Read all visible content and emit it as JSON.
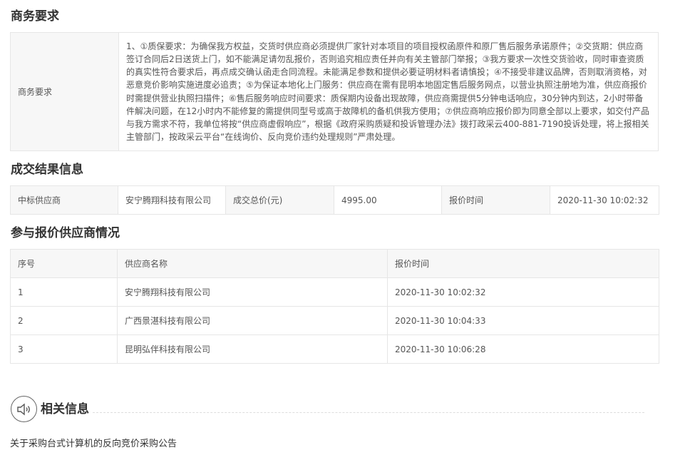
{
  "business": {
    "section_title": "商务要求",
    "label": "商务要求",
    "content": "1、①质保要求：为确保我方权益，交货时供应商必须提供厂家针对本项目的项目授权函原件和原厂售后服务承诺原件；②交货期：供应商签订合同后2日送货上门，如不能满足请勿乱报价，否则追究相应责任并向有关主管部门举报；③我方要求一次性交货验收，同时审查资质的真实性符合要求后，再点成交确认函走合同流程。未能满足参数和提供必要证明材料者请慎投；④不接受非建议品牌，否则取消资格，对恶意竞价影响实施进度必追责；⑤为保证本地化上门服务：供应商在需有昆明本地固定售后服务网点，以营业执照注册地为准，供应商报价时需提供营业执照扫描件；⑥售后服务响应时间要求：质保期内设备出现故障，供应商需提供5分钟电话响应，30分钟内到达，2小时带备件解决问题，在12小时内不能修复的需提供同型号或高于故障机的备机供我方使用；⑦供应商响应报价即为同意全部以上要求，如交付产品与我方需求不符，我单位将按“供应商虚假响应”，根据《政府采购质疑和投诉管理办法》拨打政采云400-881-7190投诉处理，将上报相关主管部门，按政采云平台“在线询价、反向竞价违约处理规则”严肃处理。"
  },
  "result": {
    "section_title": "成交结果信息",
    "winner_label": "中标供应商",
    "winner_value": "安宁腾翔科技有限公司",
    "total_label": "成交总价(元)",
    "total_value": "4995.00",
    "time_label": "报价时间",
    "time_value": "2020-11-30 10:02:32"
  },
  "bids": {
    "section_title": "参与报价供应商情况",
    "headers": [
      "序号",
      "供应商名称",
      "报价时间"
    ],
    "rows": [
      {
        "no": "1",
        "name": "安宁腾翔科技有限公司",
        "time": "2020-11-30 10:02:32"
      },
      {
        "no": "2",
        "name": "广西景湛科技有限公司",
        "time": "2020-11-30 10:04:33"
      },
      {
        "no": "3",
        "name": "昆明弘伴科技有限公司",
        "time": "2020-11-30 10:06:28"
      }
    ]
  },
  "related": {
    "title": "相关信息",
    "icon": "speaker-icon",
    "link": "关于采购台式计算机的反向竞价采购公告"
  }
}
